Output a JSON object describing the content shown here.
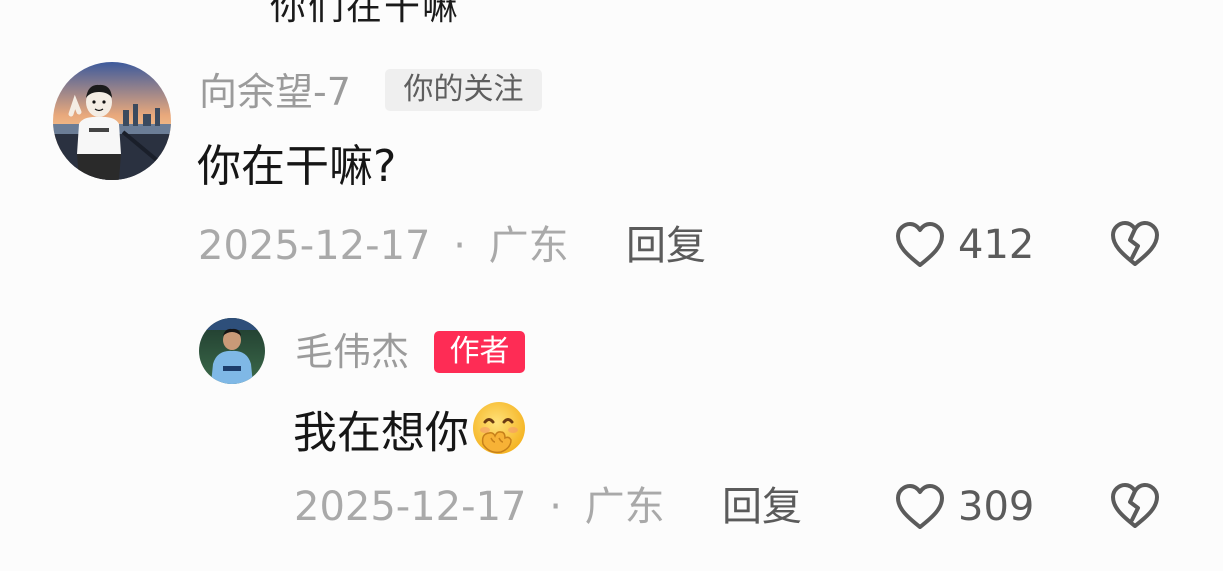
{
  "top_partial_text": "你们在干嘛",
  "comments": [
    {
      "username": "向余望-7",
      "tag": "你的关注",
      "text": "你在干嘛?",
      "date": "2025-12-17",
      "separator": "·",
      "location": "广东",
      "reply_label": "回复",
      "likes": "412"
    }
  ],
  "replies": [
    {
      "username": "毛伟杰",
      "tag": "作者",
      "text": "我在想你",
      "emoji": "hand-over-mouth-emoji",
      "date": "2025-12-17",
      "separator": "·",
      "location": "广东",
      "reply_label": "回复",
      "likes": "309"
    }
  ],
  "colors": {
    "author_tag": "#fe2c55",
    "follow_tag_bg": "#efefef",
    "meta_text": "#a9a9a9",
    "name_text": "#9b9b9b"
  }
}
